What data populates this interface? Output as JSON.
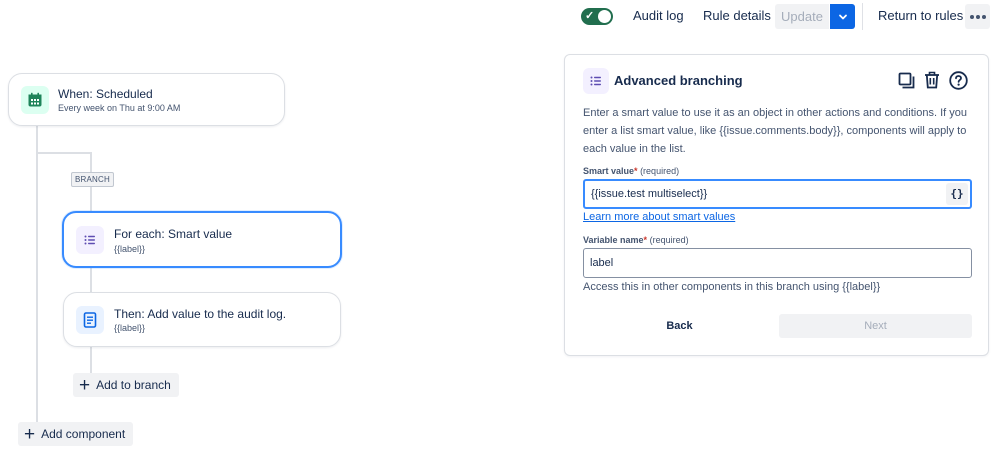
{
  "toolbar": {
    "enabled_toggle": "on",
    "audit_log": "Audit log",
    "rule_details": "Rule details",
    "update": "Update",
    "return_to_rules": "Return to rules"
  },
  "flow": {
    "trigger": {
      "title": "When: Scheduled",
      "subtitle": "Every week on Thu at 9:00 AM"
    },
    "branch_tag": "BRANCH",
    "branch_node": {
      "title": "For each: Smart value",
      "subtitle": "{{label}}"
    },
    "action_node": {
      "title": "Then: Add value to the audit log.",
      "subtitle": "{{label}}"
    },
    "add_to_branch": "Add to branch",
    "add_component": "Add component"
  },
  "panel": {
    "title": "Advanced branching",
    "description": "Enter a smart value to use it as an object in other actions and conditions. If you enter a list smart value, like {{issue.comments.body}}, components will apply to each value in the list.",
    "smart_value_label": "Smart value",
    "smart_value_required": "(required)",
    "smart_value": "{{issue.test multiselect}}",
    "brace_button": "{}",
    "learn_more": "Learn more about smart values",
    "variable_name_label": "Variable name",
    "variable_name_required": "(required)",
    "variable_name": "label",
    "help_text": "Access this in other components in this branch using {{label}}",
    "back": "Back",
    "next": "Next"
  },
  "colors": {
    "accent_blue": "#0c66e4",
    "selected_border": "#388bff",
    "toggle_green": "#216e4e",
    "trigger_icon_green": "#1f845a"
  }
}
